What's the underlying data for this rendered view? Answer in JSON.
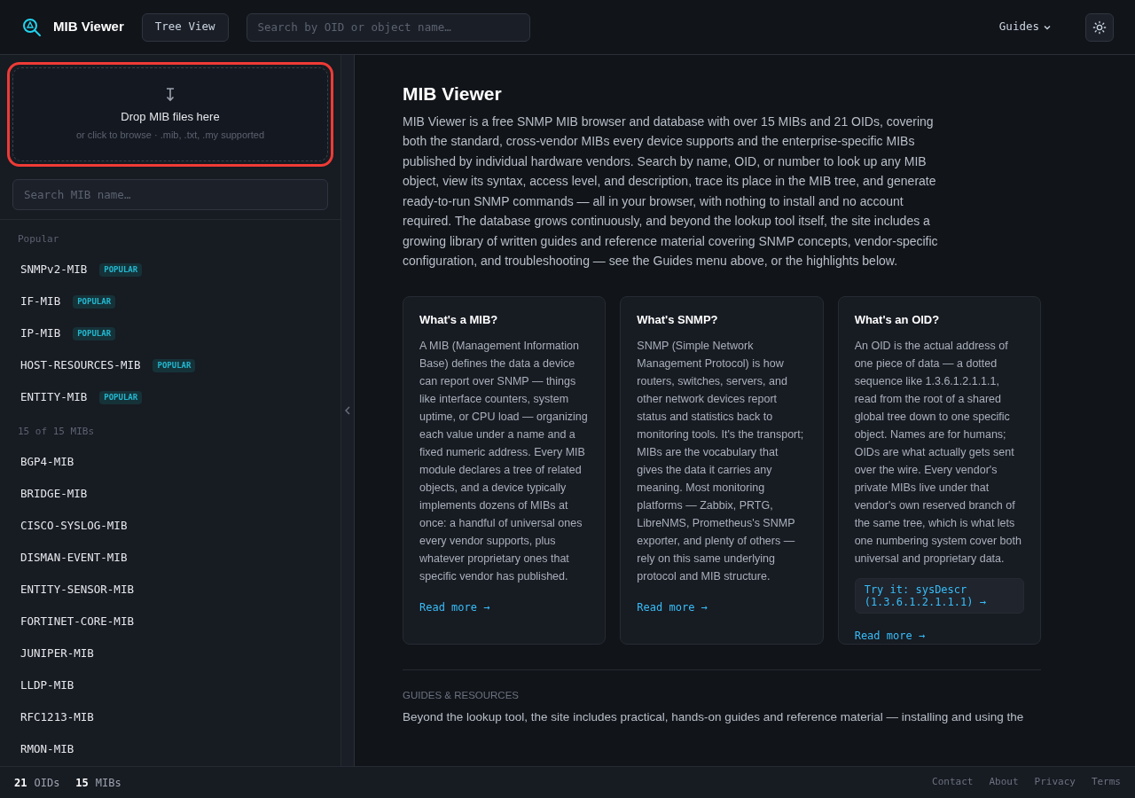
{
  "header": {
    "title": "MIB Viewer",
    "tree_button": "Tree View",
    "search": {
      "placeholder": "Search by OID or object name…"
    },
    "guides_menu": "Guides"
  },
  "dropzone": {
    "title": "Drop MIB files here",
    "hint": "or click to browse · .mib, .txt, .my supported",
    "highlighted": true
  },
  "sidebar": {
    "search": {
      "placeholder": "Search MIB name…"
    },
    "sections": [
      {
        "heading": "Popular",
        "items": [
          {
            "name": "SNMPv2-MIB",
            "badge": "POPULAR"
          },
          {
            "name": "IF-MIB",
            "badge": "POPULAR"
          },
          {
            "name": "IP-MIB",
            "badge": "POPULAR"
          },
          {
            "name": "HOST-RESOURCES-MIB",
            "badge": "POPULAR"
          },
          {
            "name": "ENTITY-MIB",
            "badge": "POPULAR"
          }
        ]
      },
      {
        "heading": "15 of 15 MIBs",
        "items": [
          {
            "name": "BGP4-MIB"
          },
          {
            "name": "BRIDGE-MIB"
          },
          {
            "name": "CISCO-SYSLOG-MIB"
          },
          {
            "name": "DISMAN-EVENT-MIB"
          },
          {
            "name": "ENTITY-SENSOR-MIB"
          },
          {
            "name": "FORTINET-CORE-MIB"
          },
          {
            "name": "JUNIPER-MIB"
          },
          {
            "name": "LLDP-MIB"
          },
          {
            "name": "RFC1213-MIB"
          },
          {
            "name": "RMON-MIB"
          }
        ]
      }
    ]
  },
  "main": {
    "title": "MIB Viewer",
    "intro": "MIB Viewer is a free SNMP MIB browser and database with over 15 MIBs and 21 OIDs, covering both the standard, cross-vendor MIBs every device supports and the enterprise-specific MIBs published by individual hardware vendors. Search by name, OID, or number to look up any MIB object, view its syntax, access level, and description, trace its place in the MIB tree, and generate ready-to-run SNMP commands — all in your browser, with nothing to install and no account required. The database grows continuously, and beyond the lookup tool itself, the site includes a growing library of written guides and reference material covering SNMP concepts, vendor-specific configuration, and troubleshooting — see the Guides menu above, or the highlights below.",
    "cards": [
      {
        "title": "What's a MIB?",
        "body": "A MIB (Management Information Base) defines the data a device can report over SNMP — things like interface counters, system uptime, or CPU load — organizing each value under a name and a fixed numeric address. Every MIB module declares a tree of related objects, and a device typically implements dozens of MIBs at once: a handful of universal ones every vendor supports, plus whatever proprietary ones that specific vendor has published.",
        "link": "Read more →"
      },
      {
        "title": "What's SNMP?",
        "body": "SNMP (Simple Network Management Protocol) is how routers, switches, servers, and other network devices report status and statistics back to monitoring tools. It's the transport; MIBs are the vocabulary that gives the data it carries any meaning. Most monitoring platforms — Zabbix, PRTG, LibreNMS, Prometheus's SNMP exporter, and plenty of others — rely on this same underlying protocol and MIB structure.",
        "link": "Read more →"
      },
      {
        "title": "What's an OID?",
        "body": "An OID is the actual address of one piece of data — a dotted sequence like 1.3.6.1.2.1.1.1, read from the root of a shared global tree down to one specific object. Names are for humans; OIDs are what actually gets sent over the wire. Every vendor's private MIBs live under that vendor's own reserved branch of the same tree, which is what lets one numbering system cover both universal and proprietary data.",
        "try_it": "Try it: sysDescr (1.3.6.1.2.1.1.1) →",
        "link": "Read more →"
      }
    ],
    "guides_heading": "GUIDES & RESOURCES",
    "guides_text": "Beyond the lookup tool, the site includes practical, hands-on guides and reference material — installing and using the"
  },
  "status_bar": {
    "oid_count": "21",
    "oid_label": "OIDs",
    "mib_count": "15",
    "mib_label": "MIBs",
    "links": [
      "Contact",
      "About",
      "Privacy",
      "Terms"
    ]
  }
}
